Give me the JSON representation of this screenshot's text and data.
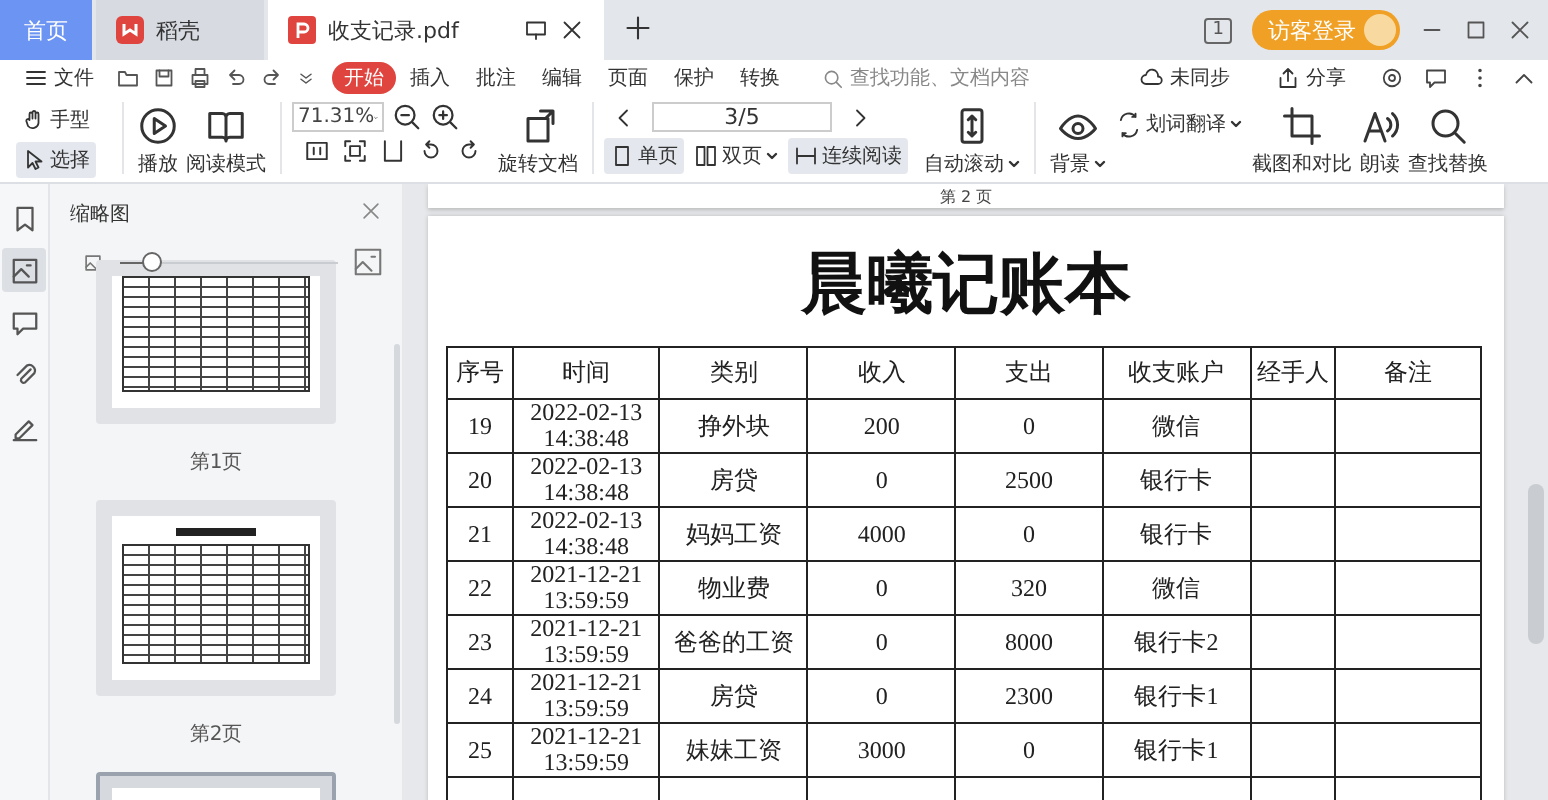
{
  "tabs": [
    {
      "label": "首页",
      "kind": "home",
      "selected": false
    },
    {
      "label": "稻壳",
      "kind": "app",
      "selected": false
    },
    {
      "label": "收支记录.pdf",
      "kind": "doc",
      "selected": true
    }
  ],
  "title_bar": {
    "window_badge": "1",
    "login_button": "访客登录"
  },
  "menu": {
    "file": "文件",
    "tabs": [
      {
        "label": "开始",
        "selected": true
      },
      {
        "label": "插入",
        "selected": false
      },
      {
        "label": "批注",
        "selected": false
      },
      {
        "label": "编辑",
        "selected": false
      },
      {
        "label": "页面",
        "selected": false
      },
      {
        "label": "保护",
        "selected": false
      },
      {
        "label": "转换",
        "selected": false
      }
    ],
    "search": {
      "placeholder": "查找功能、文档内容"
    },
    "sync": "未同步",
    "share": "分享"
  },
  "toolbar": {
    "tools": [
      {
        "label": "手型",
        "kind": "hand",
        "selected": false
      },
      {
        "label": "选择",
        "kind": "select",
        "selected": true
      }
    ],
    "play": "播放",
    "read_mode": "阅读模式",
    "zoom": "71.31%",
    "rotate": "旋转文档",
    "page": "3/5",
    "views": [
      {
        "label": "单页",
        "kind": "single",
        "selected": true
      },
      {
        "label": "双页",
        "kind": "double",
        "selected": false
      },
      {
        "label": "连续阅读",
        "kind": "continuous",
        "selected": true
      }
    ],
    "auto_scroll": "自动滚动",
    "background": "背景",
    "translate": "划词翻译",
    "compare": "截图和对比",
    "read_aloud": "朗读",
    "find_replace": "查找替换"
  },
  "sidebar": {
    "icons": [
      {
        "kind": "bookmark",
        "selected": false
      },
      {
        "kind": "thumbnail",
        "selected": true
      },
      {
        "kind": "comment",
        "selected": false
      },
      {
        "kind": "attachment",
        "selected": false
      },
      {
        "kind": "signature",
        "selected": false
      }
    ],
    "panel": {
      "title": "缩略图",
      "level": 0.15,
      "thumbnails": [
        {
          "label": "第1页",
          "kind": "cut",
          "selected": false
        },
        {
          "label": "第2页",
          "kind": "full",
          "selected": false
        },
        {
          "kind": "full",
          "selected": true
        }
      ]
    }
  },
  "document": {
    "previous_page_label": "第 2 页",
    "title": "晨曦记账本",
    "columns": [
      "序号",
      "时间",
      "类别",
      "收入",
      "支出",
      "收支账户",
      "经手人",
      "备注"
    ],
    "rows": [
      {
        "no": "19",
        "time": "2022-02-13 14:38:48",
        "category": "挣外块",
        "income": "200",
        "expense": "0",
        "account": "微信"
      },
      {
        "no": "20",
        "time": "2022-02-13 14:38:48",
        "category": "房贷",
        "income": "0",
        "expense": "2500",
        "account": "银行卡"
      },
      {
        "no": "21",
        "time": "2022-02-13 14:38:48",
        "category": "妈妈工资",
        "income": "4000",
        "expense": "0",
        "account": "银行卡"
      },
      {
        "no": "22",
        "time": "2021-12-21 13:59:59",
        "category": "物业费",
        "income": "0",
        "expense": "320",
        "account": "微信"
      },
      {
        "no": "23",
        "time": "2021-12-21 13:59:59",
        "category": "爸爸的工资",
        "income": "0",
        "expense": "8000",
        "account": "银行卡2"
      },
      {
        "no": "24",
        "time": "2021-12-21 13:59:59",
        "category": "房贷",
        "income": "0",
        "expense": "2300",
        "account": "银行卡1"
      },
      {
        "no": "25",
        "time": "2021-12-21 13:59:59",
        "category": "妹妹工资",
        "income": "3000",
        "expense": "0",
        "account": "银行卡1"
      }
    ]
  }
}
